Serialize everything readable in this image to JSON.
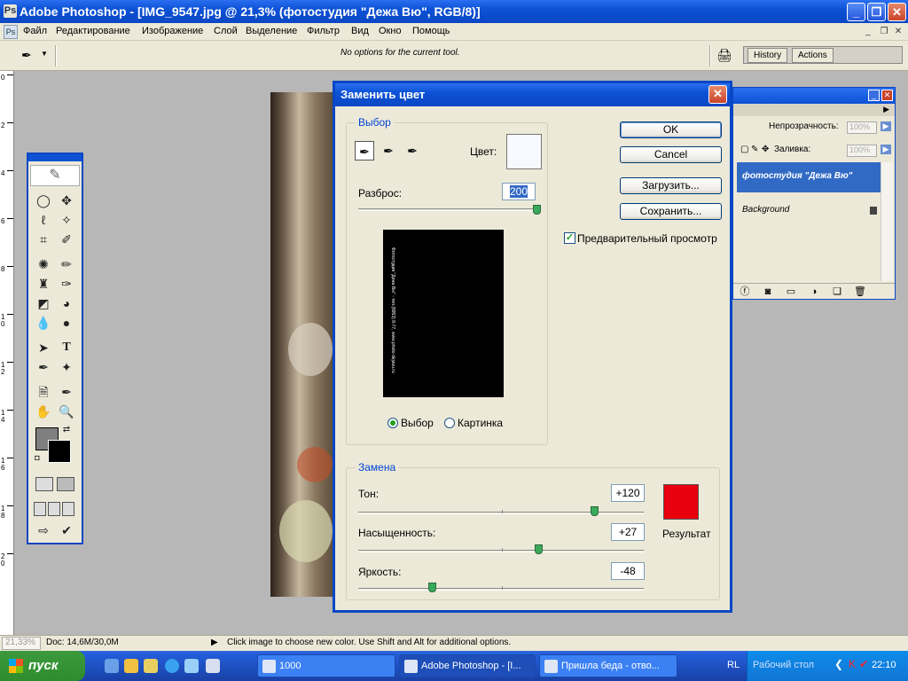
{
  "window": {
    "title": "Adobe Photoshop - [IMG_9547.jpg @ 21,3% (фотостудия \"Дежа Вю\", RGB/8)]"
  },
  "menu": [
    "Файл",
    "Редактирование",
    "Изображение",
    "Слой",
    "Выделение",
    "Фильтр",
    "Вид",
    "Окно",
    "Помощь"
  ],
  "options_bar": {
    "message": "No options for the current tool.",
    "well_tabs": [
      "History",
      "Actions"
    ]
  },
  "ruler": {
    "labels": [
      "0",
      "2",
      "4",
      "6",
      "8",
      "1\n0",
      "1\n2",
      "1\n4",
      "1\n6",
      "1\n8",
      "2\n0"
    ]
  },
  "layers_panel": {
    "opacity_label": "Непрозрачность:",
    "opacity_value": "100%",
    "fill_label": "Заливка:",
    "fill_value": "100%",
    "layers": [
      {
        "name": "фотостудия \"Дежа Вю\"",
        "selected": true
      },
      {
        "name": "Background",
        "selected": false,
        "locked": true
      }
    ]
  },
  "dialog": {
    "title": "Заменить цвет",
    "selection_group": "Выбор",
    "color_label": "Цвет:",
    "color_swatch": "#f8f8ff",
    "fuzziness_label": "Разброс:",
    "fuzziness_value": "200",
    "fuzziness_level": 1.0,
    "radio_selection": "Выбор",
    "radio_image": "Картинка",
    "preview_mode": "selection",
    "buttons": {
      "ok": "OK",
      "cancel": "Cancel",
      "load": "Загрузить...",
      "save": "Сохранить..."
    },
    "preview_checkbox": "Предварительный просмотр",
    "preview_checked": true,
    "replacement_group": "Замена",
    "hue_label": "Тон:",
    "hue_value": "+120",
    "hue_level": 0.83,
    "saturation_label": "Насыщенность:",
    "saturation_value": "+27",
    "saturation_level": 0.635,
    "lightness_label": "Яркость:",
    "lightness_value": "-48",
    "lightness_level": 0.26,
    "result_label": "Результат",
    "result_color": "#e8000e",
    "mask_text": "Фотостудия \"Дежа Вю\" - тел.(8953) 8-77, www.photo-dejavu.ru"
  },
  "status_bar": {
    "zoom": "21,33%",
    "doc": "Doc: 14,6M/30,0M",
    "message": "Click image to choose new color.  Use Shift and Alt for additional options."
  },
  "taskbar": {
    "start": "пуск",
    "items": [
      {
        "label": "1000",
        "active": false
      },
      {
        "label": "Adobe Photoshop - [I...",
        "active": true
      },
      {
        "label": "Пришла беда - отво...",
        "active": false
      }
    ],
    "lang": "RL",
    "desktop": "Рабочий стол",
    "clock": "22:10"
  },
  "colors": {
    "title_blue": "#0d52d6",
    "dialog_face": "#ece9d8",
    "foreground": "#7f7f7f",
    "background": "#000000"
  }
}
